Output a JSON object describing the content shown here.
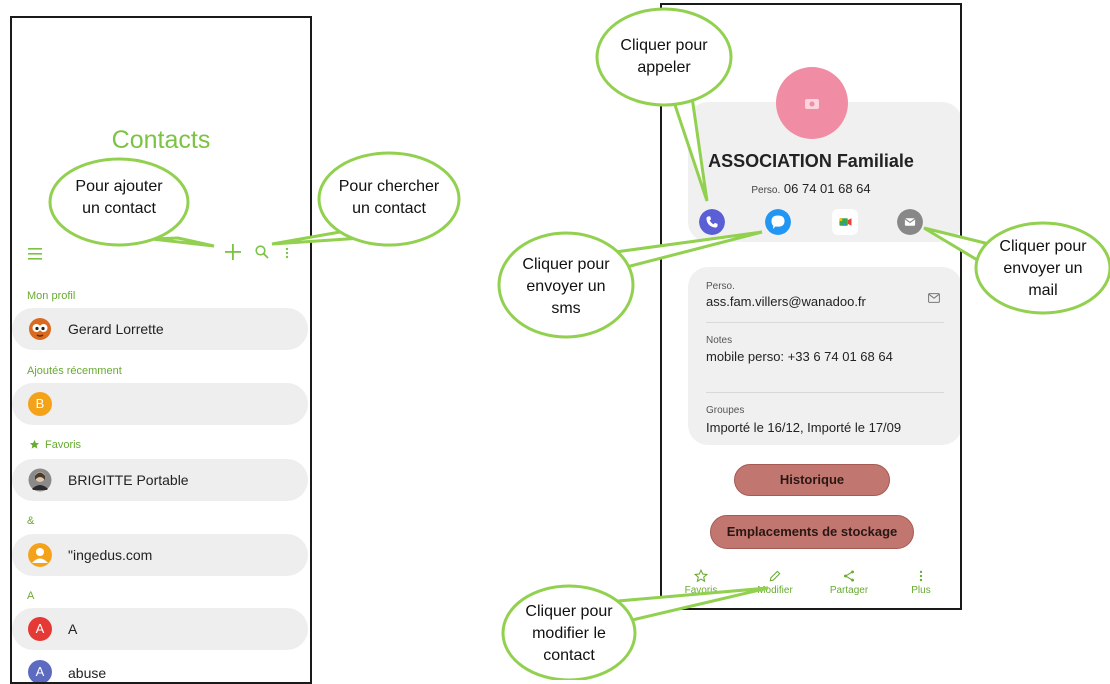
{
  "contacts_screen": {
    "title": "Contacts",
    "sections": {
      "my_profile": "Mon profil",
      "recent": "Ajoutés récemment",
      "favorites": "Favoris",
      "symbols": "&",
      "letter_a": "A"
    },
    "profile_name": "Gerard Lorrette",
    "recent_initial": "B",
    "favorite_name": "BRIGITTE Portable",
    "symbol_contact": "\"ingedus.com",
    "a_contacts": [
      {
        "initial": "A",
        "name": "A"
      },
      {
        "initial": "A",
        "name": "abuse"
      }
    ]
  },
  "contact_detail": {
    "name": "ASSOCIATION Familiale",
    "phone_type": "Perso.",
    "phone": "06 74 01 68 64",
    "email_label": "Perso.",
    "email": "ass.fam.villers@wanadoo.fr",
    "notes_label": "Notes",
    "notes": "mobile perso: +33 6 74 01 68 64",
    "groups_label": "Groupes",
    "groups": "Importé le 16/12, Importé le 17/09",
    "history_button": "Historique",
    "storage_button": "Emplacements de stockage",
    "bottom_nav": {
      "favorites": "Favoris",
      "edit": "Modifier",
      "share": "Partager",
      "more": "Plus"
    }
  },
  "callouts": {
    "add": [
      "Pour ajouter",
      "un contact"
    ],
    "search": [
      "Pour chercher",
      "un contact"
    ],
    "call": [
      "Cliquer pour",
      "appeler"
    ],
    "sms": [
      "Cliquer pour",
      "envoyer un",
      "sms"
    ],
    "mail": [
      "Cliquer pour",
      "envoyer un",
      "mail"
    ],
    "edit": [
      "Cliquer pour",
      "modifier le",
      "contact"
    ]
  },
  "colors": {
    "accent_green": "#7cc343",
    "callout_border": "#92d050",
    "action_button": "#c17770",
    "avatar_pink": "#f08ca3",
    "call_icon": "#5b5fd6",
    "sms_icon": "#2196f3",
    "mail_icon": "#888888"
  },
  "icons": [
    "menu-icon",
    "plus-icon",
    "search-icon",
    "more-vert-icon",
    "star-icon",
    "phone-icon",
    "message-icon",
    "video-icon",
    "mail-icon",
    "pencil-icon",
    "share-icon"
  ]
}
